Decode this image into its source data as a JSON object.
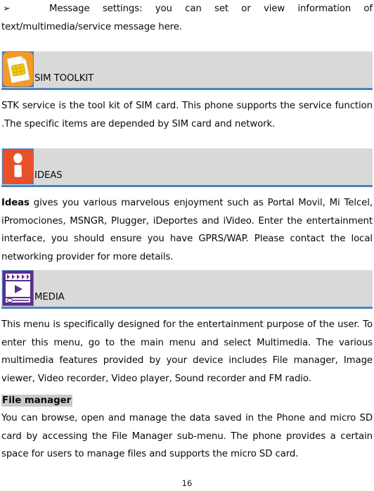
{
  "document": {
    "page_number": "16",
    "colors": {
      "heading_band": "#d9d9d9",
      "heading_rule": "#4f81bd",
      "highlight": "#c9c9c9",
      "sim_icon_bg": "#f59a23",
      "ideas_icon_bg": "#e8502a",
      "media_icon": "#5b2d8e"
    }
  },
  "bullet_item": {
    "glyph": "➢",
    "text": "Message settings: you can set or view information of text/multimedia/service message here."
  },
  "sections": [
    {
      "icon_name": "sim-card-icon",
      "title": "SIM TOOLKIT",
      "body": "STK service is the tool kit of SIM card. This phone supports the service function .The specific items are depended by SIM card and network."
    },
    {
      "icon_name": "info-idea-icon",
      "title": "IDEAS",
      "body_lead": "Ideas",
      "body": " gives you various marvelous enjoyment such as Portal Movil, Mi Telcel, iPromociones, MSNGR, Plugger, iDeportes and iVideo. Enter the entertainment interface, you should ensure you have GPRS/WAP. Please contact the local networking provider for more details."
    },
    {
      "icon_name": "media-clapperboard-icon",
      "title": "MEDIA",
      "body": "This menu is specifically designed for the entertainment purpose of the user. To enter this menu, go to the main menu and select Multimedia. The various multimedia features provided by your device includes File manager, Image viewer, Video recorder, Video player, Sound recorder and FM radio.",
      "subsection": {
        "title": "File manager",
        "body": "You can browse, open and manage the data saved in the Phone and micro SD card by accessing the File Manager sub-menu. The phone provides a certain space for users to manage files and supports the micro SD card."
      }
    }
  ]
}
